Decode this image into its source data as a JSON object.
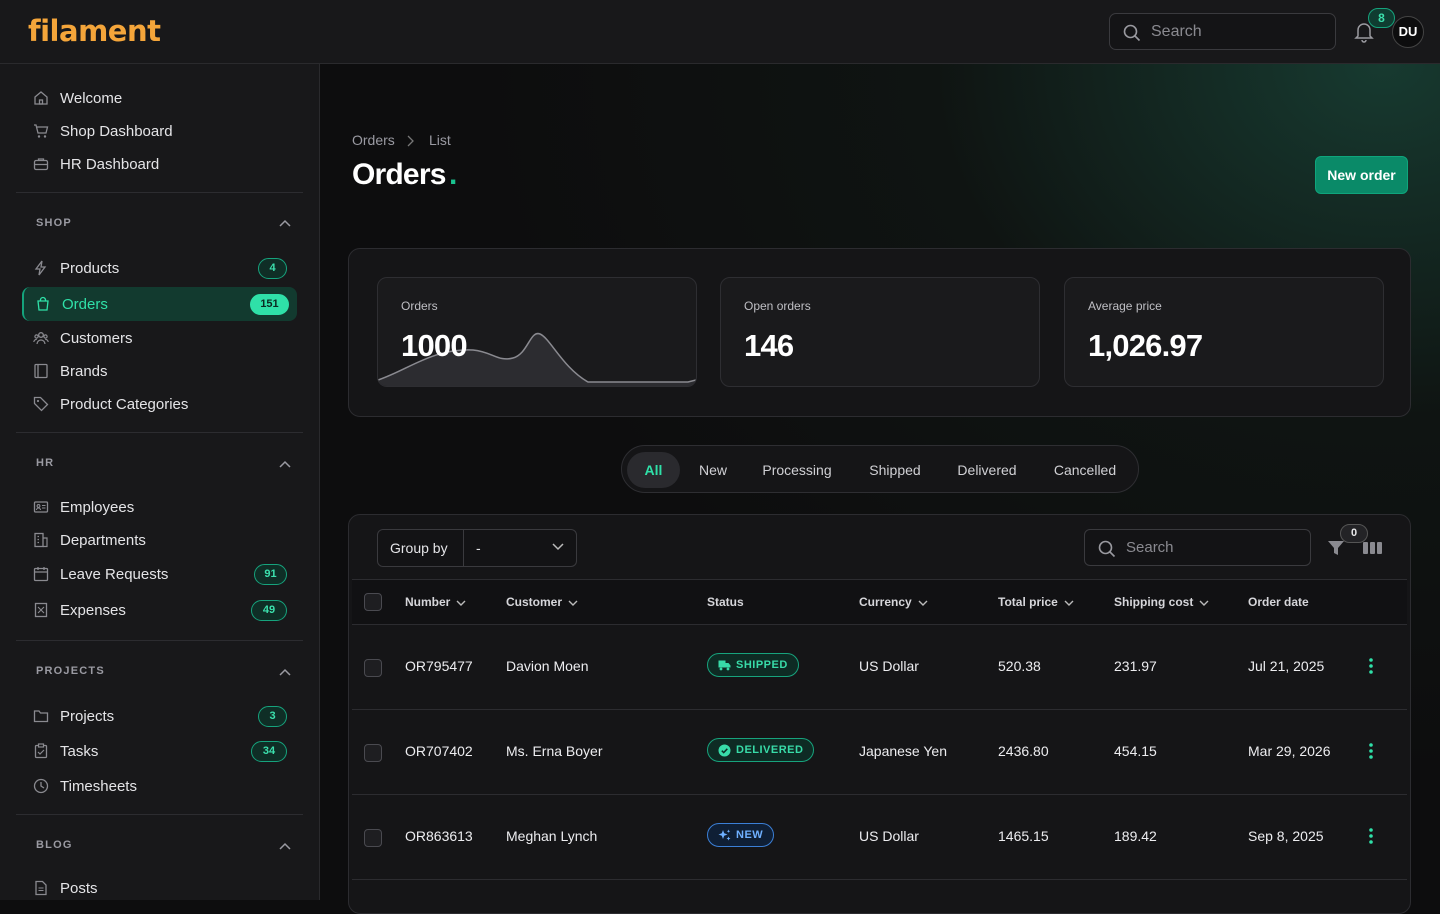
{
  "app": {
    "logo": "filament"
  },
  "topbar": {
    "search_placeholder": "Search",
    "notifications_count": "8",
    "avatar_initials": "DU"
  },
  "sidebar": {
    "top_items": [
      {
        "label": "Welcome",
        "icon": "home-icon"
      },
      {
        "label": "Shop Dashboard",
        "icon": "cart-icon"
      },
      {
        "label": "HR Dashboard",
        "icon": "briefcase-icon"
      }
    ],
    "groups": [
      {
        "title": "SHOP",
        "items": [
          {
            "label": "Products",
            "count": "4",
            "icon": "bolt-icon"
          },
          {
            "label": "Orders",
            "count": "151",
            "icon": "bag-icon",
            "active": true
          },
          {
            "label": "Customers",
            "icon": "users-icon"
          },
          {
            "label": "Brands",
            "icon": "book-icon"
          },
          {
            "label": "Product Categories",
            "icon": "tag-icon"
          }
        ]
      },
      {
        "title": "HR",
        "items": [
          {
            "label": "Employees",
            "icon": "id-card-icon"
          },
          {
            "label": "Departments",
            "icon": "building-icon"
          },
          {
            "label": "Leave Requests",
            "count": "91",
            "icon": "calendar-icon"
          },
          {
            "label": "Expenses",
            "count": "49",
            "icon": "receipt-icon"
          }
        ]
      },
      {
        "title": "PROJECTS",
        "items": [
          {
            "label": "Projects",
            "count": "3",
            "icon": "folder-icon"
          },
          {
            "label": "Tasks",
            "count": "34",
            "icon": "clipboard-icon"
          },
          {
            "label": "Timesheets",
            "icon": "clock-icon"
          }
        ]
      },
      {
        "title": "BLOG",
        "items": [
          {
            "label": "Posts",
            "icon": "document-icon"
          }
        ]
      }
    ]
  },
  "page": {
    "breadcrumb": [
      "Orders",
      "List"
    ],
    "title": "Orders",
    "title_dot": ".",
    "new_button": "New order"
  },
  "stats": [
    {
      "label": "Orders",
      "value": "1000"
    },
    {
      "label": "Open orders",
      "value": "146"
    },
    {
      "label": "Average price",
      "value": "1,026.97"
    }
  ],
  "tabs": [
    {
      "label": "All",
      "active": true
    },
    {
      "label": "New"
    },
    {
      "label": "Processing"
    },
    {
      "label": "Shipped"
    },
    {
      "label": "Delivered"
    },
    {
      "label": "Cancelled"
    }
  ],
  "table": {
    "group_by_label": "Group by",
    "group_by_value": "-",
    "search_placeholder": "Search",
    "filter_count": "0",
    "columns": [
      "Number",
      "Customer",
      "Status",
      "Currency",
      "Total price",
      "Shipping cost",
      "Order date"
    ],
    "rows": [
      {
        "number": "OR795477",
        "customer": "Davion Moen",
        "status": "SHIPPED",
        "currency": "US Dollar",
        "total": "520.38",
        "shipping": "231.97",
        "date": "Jul 21, 2025"
      },
      {
        "number": "OR707402",
        "customer": "Ms. Erna Boyer",
        "status": "DELIVERED",
        "currency": "Japanese Yen",
        "total": "2436.80",
        "shipping": "454.15",
        "date": "Mar 29, 2026"
      },
      {
        "number": "OR863613",
        "customer": "Meghan Lynch",
        "status": "NEW",
        "currency": "US Dollar",
        "total": "1465.15",
        "shipping": "189.42",
        "date": "Sep 8, 2025"
      }
    ]
  },
  "colors": {
    "accent": "#2fe0a8",
    "brand": "#f4a53a",
    "primary_button": "#0a8a68",
    "new_badge": "#6fb0ff"
  }
}
